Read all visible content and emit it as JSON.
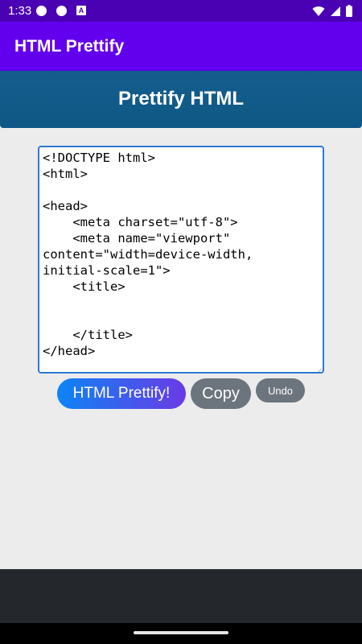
{
  "status_bar": {
    "time": "1:33",
    "notification_icons": [
      "circle-icon",
      "circle-icon",
      "a-icon"
    ],
    "right_icons": [
      "wifi-icon",
      "cellular-signal-icon",
      "battery-icon"
    ],
    "a_glyph": "A"
  },
  "app_bar": {
    "title": "HTML Prettify",
    "color": "#6200ee"
  },
  "header": {
    "title": "Prettify HTML",
    "color": "#145d8c"
  },
  "editor": {
    "value": "<!DOCTYPE html>\n<html>\n\n<head>\n    <meta charset=\"utf-8\">\n    <meta name=\"viewport\" content=\"width=device-width, initial-scale=1\">\n    <title>\n\n\n    </title>\n</head>"
  },
  "buttons": {
    "prettify_label": "HTML Prettify!",
    "copy_label": "Copy",
    "undo_label": "Undo"
  },
  "colors": {
    "status_bar": "#4a00b3",
    "background": "#ececec",
    "secondary_button": "#6c757d",
    "bottom_bar": "#24272b"
  }
}
